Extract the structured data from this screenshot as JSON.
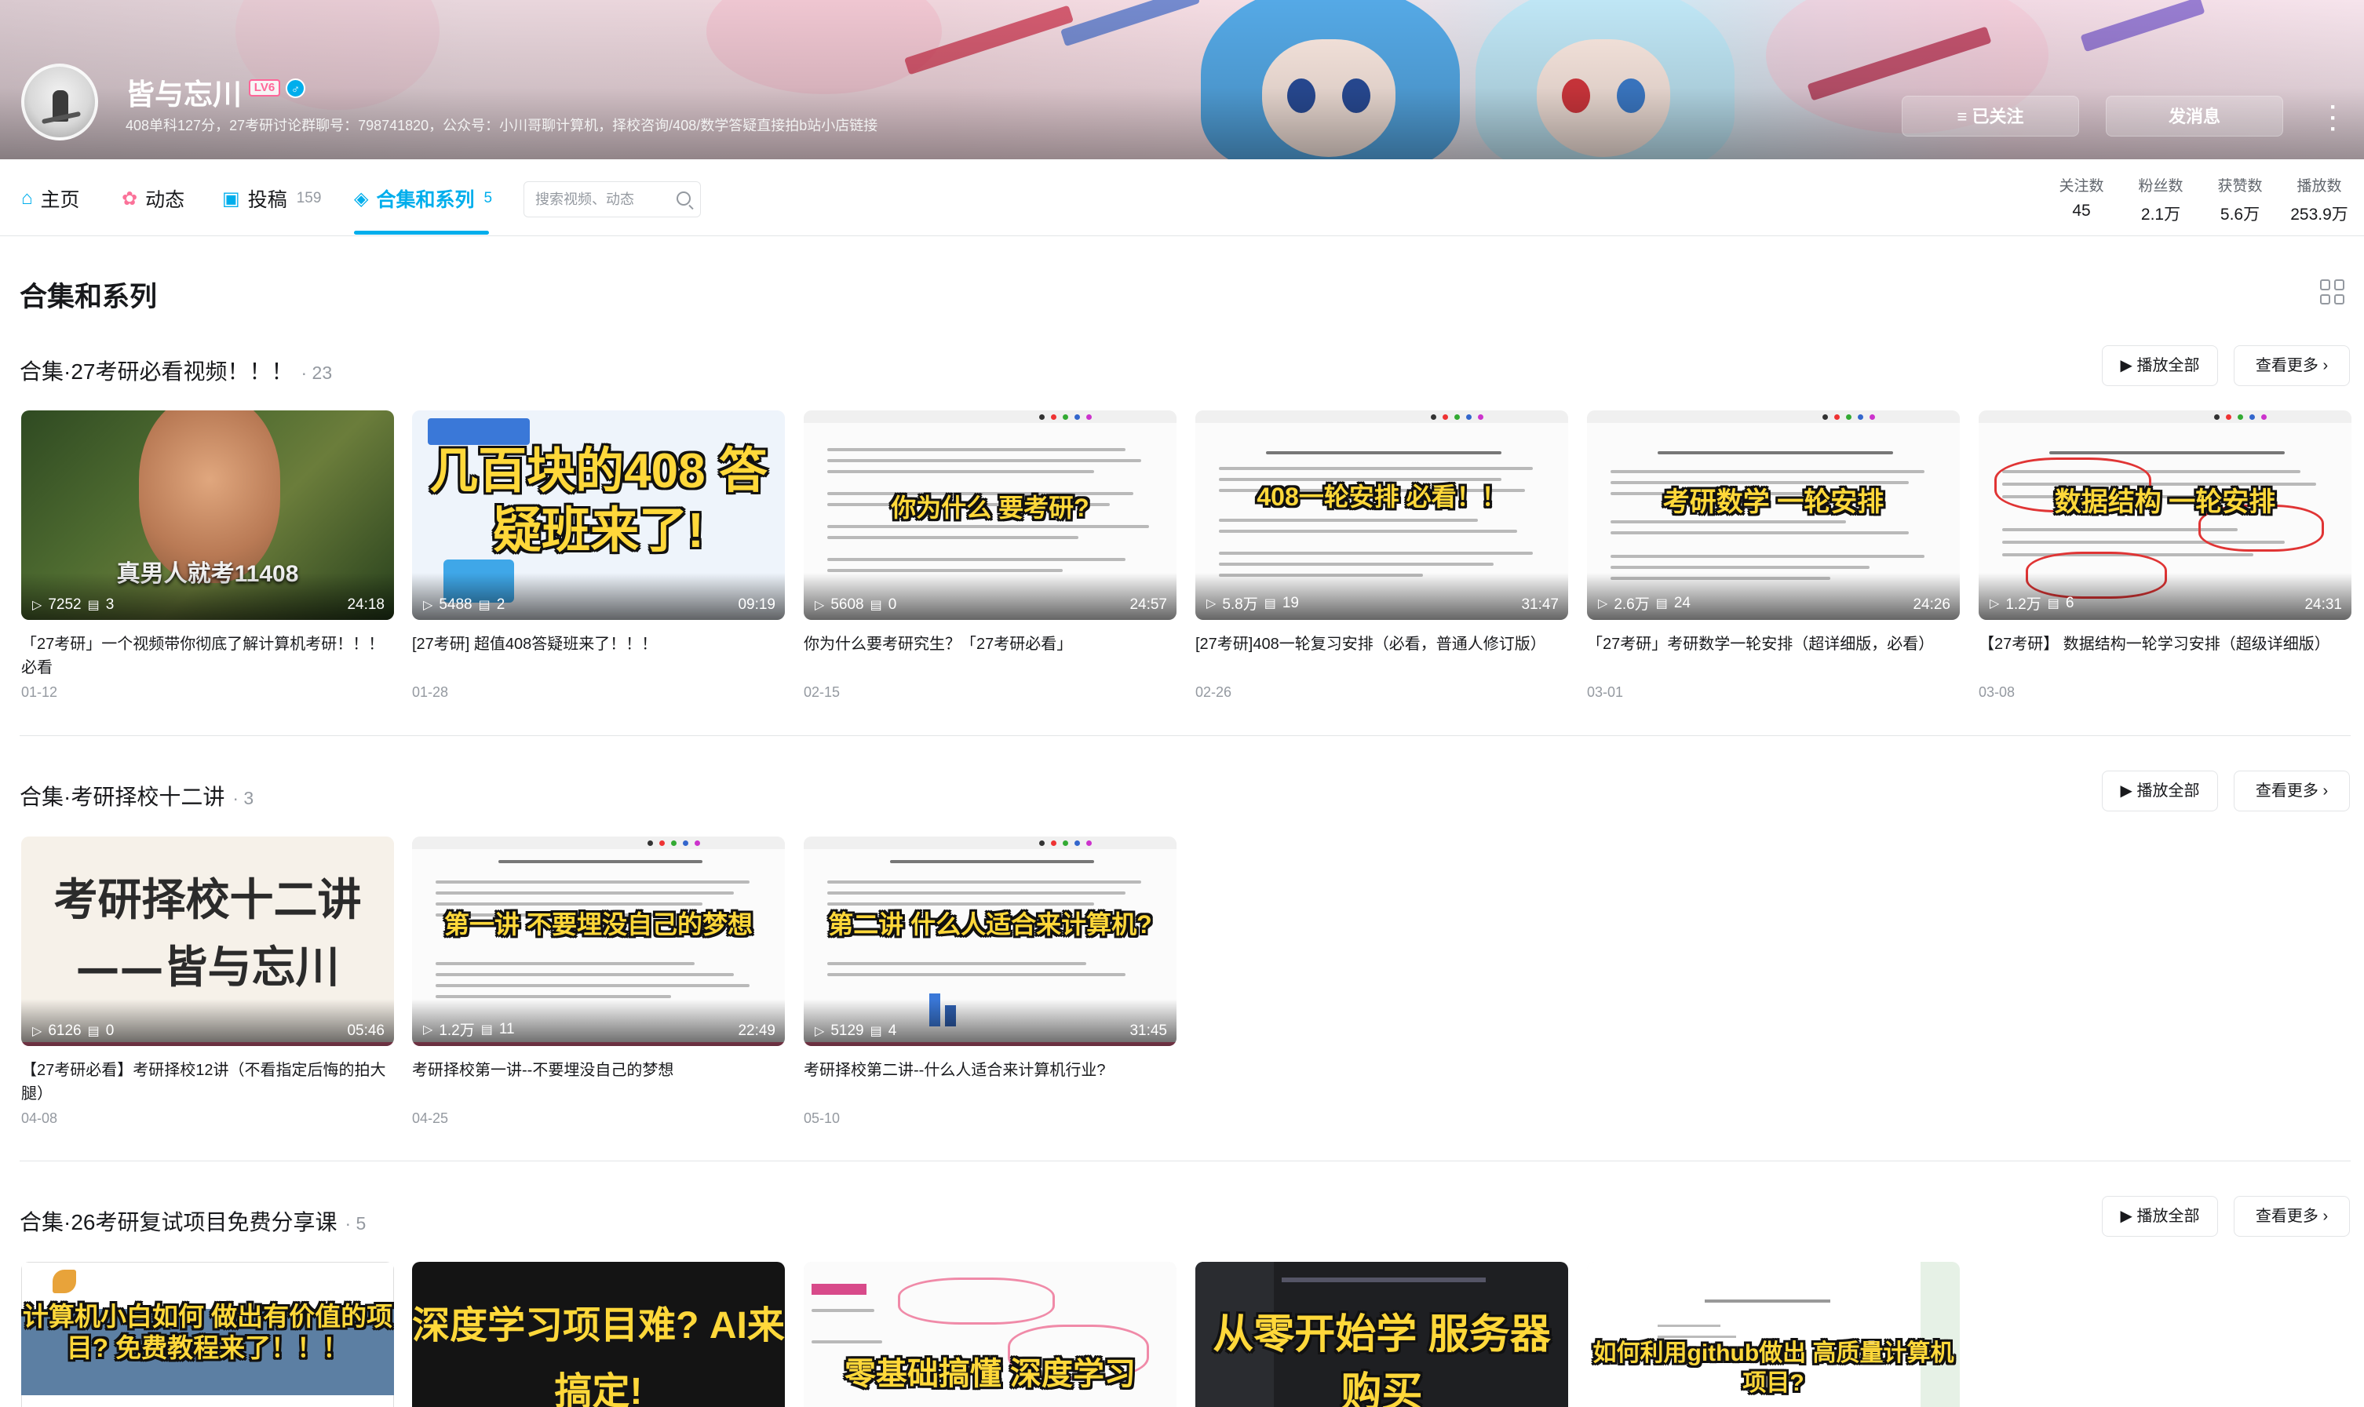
{
  "header": {
    "username": "皆与忘川",
    "level": "LV6",
    "signature": "408单科127分，27考研讨论群聊号：798741820，公众号：小川哥聊计算机，择校咨询/408/数学答疑直接拍b站小店链接",
    "follow_button": "≡ 已关注",
    "message_button": "发消息",
    "more_icon": "more-vertical-icon"
  },
  "nav": {
    "tabs": [
      {
        "icon": "⌂",
        "label": "主页",
        "count": ""
      },
      {
        "icon": "✿",
        "label": "动态",
        "count": ""
      },
      {
        "icon": "▣",
        "label": "投稿",
        "count": "159"
      },
      {
        "icon": "◈",
        "label": "合集和系列",
        "count": "5"
      }
    ],
    "search_placeholder": "搜索视频、动态",
    "stats": [
      {
        "label": "关注数",
        "value": "45"
      },
      {
        "label": "粉丝数",
        "value": "2.1万"
      },
      {
        "label": "获赞数",
        "value": "5.6万"
      },
      {
        "label": "播放数",
        "value": "253.9万"
      }
    ]
  },
  "page_title": "合集和系列",
  "buttons": {
    "play_all": "▶ 播放全部",
    "see_more": "查看更多 ›"
  },
  "sections": [
    {
      "title": "合集·27考研必看视频！！！",
      "count": "· 23",
      "cards": [
        {
          "thumb_text": "真男人就考11408",
          "views": "7252",
          "danmaku": "3",
          "duration": "24:18",
          "title": "「27考研」一个视频带你彻底了解计算机考研！！！必看",
          "date": "01-12"
        },
        {
          "thumb_text": "几百块的408 答疑班来了!",
          "views": "5488",
          "danmaku": "2",
          "duration": "09:19",
          "title": "[27考研] 超值408答疑班来了！！！",
          "date": "01-28"
        },
        {
          "thumb_text": "你为什么 要考研?",
          "views": "5608",
          "danmaku": "0",
          "duration": "24:57",
          "title": "你为什么要考研究生？「27考研必看」",
          "date": "02-15"
        },
        {
          "thumb_text": "408一轮安排 必看！！",
          "views": "5.8万",
          "danmaku": "19",
          "duration": "31:47",
          "title": "[27考研]408一轮复习安排（必看，普通人修订版）",
          "date": "02-26"
        },
        {
          "thumb_text": "考研数学 一轮安排",
          "views": "2.6万",
          "danmaku": "24",
          "duration": "24:26",
          "title": "「27考研」考研数学一轮安排（超详细版，必看）",
          "date": "03-01"
        },
        {
          "thumb_text": "数据结构 一轮安排",
          "views": "1.2万",
          "danmaku": "6",
          "duration": "24:31",
          "title": "【27考研】 数据结构一轮学习安排（超级详细版）",
          "date": "03-08"
        }
      ]
    },
    {
      "title": "合集·考研择校十二讲",
      "count": "· 3",
      "cards": [
        {
          "thumb_text": "考研择校十二讲 ——皆与忘川",
          "views": "6126",
          "danmaku": "0",
          "duration": "05:46",
          "title": "【27考研必看】考研择校12讲（不看指定后悔的拍大腿）",
          "date": "04-08"
        },
        {
          "thumb_text": "第一讲 不要埋没自己的梦想",
          "views": "1.2万",
          "danmaku": "11",
          "duration": "22:49",
          "title": "考研择校第一讲--不要埋没自己的梦想",
          "date": "04-25"
        },
        {
          "thumb_text": "第二讲 什么人适合来计算机?",
          "views": "5129",
          "danmaku": "4",
          "duration": "31:45",
          "title": "考研择校第二讲--什么人适合来计算机行业?",
          "date": "05-10"
        }
      ]
    },
    {
      "title": "合集·26考研复试项目免费分享课",
      "count": "· 5",
      "cards": [
        {
          "thumb_text": "计算机小白如何 做出有价值的项目? 免费教程来了！！！"
        },
        {
          "thumb_text": "深度学习项目难? AI来搞定!"
        },
        {
          "thumb_text": "零基础搞懂 深度学习"
        },
        {
          "thumb_text": "从零开始学 服务器购买"
        },
        {
          "thumb_text": "如何利用github做出 高质量计算机项目?"
        }
      ]
    }
  ]
}
